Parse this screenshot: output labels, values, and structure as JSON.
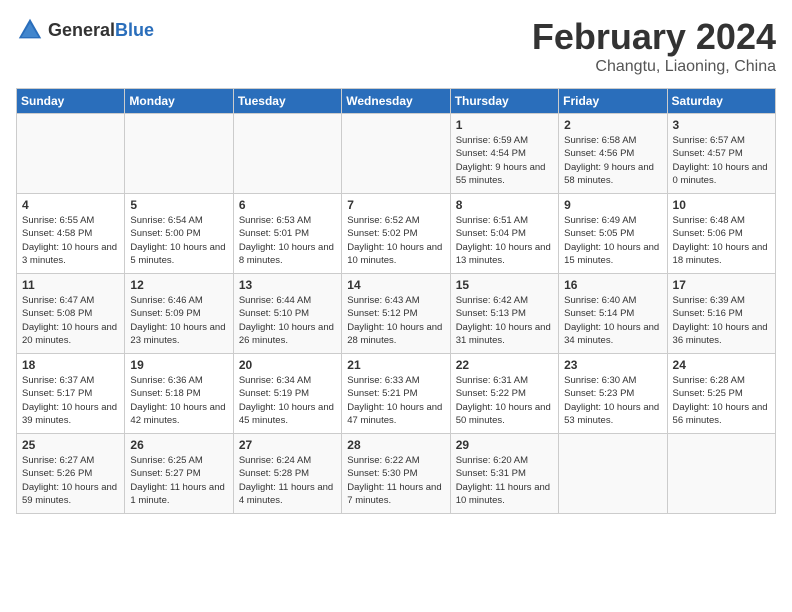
{
  "header": {
    "logo_general": "General",
    "logo_blue": "Blue",
    "month": "February 2024",
    "location": "Changtu, Liaoning, China"
  },
  "weekdays": [
    "Sunday",
    "Monday",
    "Tuesday",
    "Wednesday",
    "Thursday",
    "Friday",
    "Saturday"
  ],
  "weeks": [
    [
      {
        "day": "",
        "info": ""
      },
      {
        "day": "",
        "info": ""
      },
      {
        "day": "",
        "info": ""
      },
      {
        "day": "",
        "info": ""
      },
      {
        "day": "1",
        "info": "Sunrise: 6:59 AM\nSunset: 4:54 PM\nDaylight: 9 hours\nand 55 minutes."
      },
      {
        "day": "2",
        "info": "Sunrise: 6:58 AM\nSunset: 4:56 PM\nDaylight: 9 hours\nand 58 minutes."
      },
      {
        "day": "3",
        "info": "Sunrise: 6:57 AM\nSunset: 4:57 PM\nDaylight: 10 hours\nand 0 minutes."
      }
    ],
    [
      {
        "day": "4",
        "info": "Sunrise: 6:55 AM\nSunset: 4:58 PM\nDaylight: 10 hours\nand 3 minutes."
      },
      {
        "day": "5",
        "info": "Sunrise: 6:54 AM\nSunset: 5:00 PM\nDaylight: 10 hours\nand 5 minutes."
      },
      {
        "day": "6",
        "info": "Sunrise: 6:53 AM\nSunset: 5:01 PM\nDaylight: 10 hours\nand 8 minutes."
      },
      {
        "day": "7",
        "info": "Sunrise: 6:52 AM\nSunset: 5:02 PM\nDaylight: 10 hours\nand 10 minutes."
      },
      {
        "day": "8",
        "info": "Sunrise: 6:51 AM\nSunset: 5:04 PM\nDaylight: 10 hours\nand 13 minutes."
      },
      {
        "day": "9",
        "info": "Sunrise: 6:49 AM\nSunset: 5:05 PM\nDaylight: 10 hours\nand 15 minutes."
      },
      {
        "day": "10",
        "info": "Sunrise: 6:48 AM\nSunset: 5:06 PM\nDaylight: 10 hours\nand 18 minutes."
      }
    ],
    [
      {
        "day": "11",
        "info": "Sunrise: 6:47 AM\nSunset: 5:08 PM\nDaylight: 10 hours\nand 20 minutes."
      },
      {
        "day": "12",
        "info": "Sunrise: 6:46 AM\nSunset: 5:09 PM\nDaylight: 10 hours\nand 23 minutes."
      },
      {
        "day": "13",
        "info": "Sunrise: 6:44 AM\nSunset: 5:10 PM\nDaylight: 10 hours\nand 26 minutes."
      },
      {
        "day": "14",
        "info": "Sunrise: 6:43 AM\nSunset: 5:12 PM\nDaylight: 10 hours\nand 28 minutes."
      },
      {
        "day": "15",
        "info": "Sunrise: 6:42 AM\nSunset: 5:13 PM\nDaylight: 10 hours\nand 31 minutes."
      },
      {
        "day": "16",
        "info": "Sunrise: 6:40 AM\nSunset: 5:14 PM\nDaylight: 10 hours\nand 34 minutes."
      },
      {
        "day": "17",
        "info": "Sunrise: 6:39 AM\nSunset: 5:16 PM\nDaylight: 10 hours\nand 36 minutes."
      }
    ],
    [
      {
        "day": "18",
        "info": "Sunrise: 6:37 AM\nSunset: 5:17 PM\nDaylight: 10 hours\nand 39 minutes."
      },
      {
        "day": "19",
        "info": "Sunrise: 6:36 AM\nSunset: 5:18 PM\nDaylight: 10 hours\nand 42 minutes."
      },
      {
        "day": "20",
        "info": "Sunrise: 6:34 AM\nSunset: 5:19 PM\nDaylight: 10 hours\nand 45 minutes."
      },
      {
        "day": "21",
        "info": "Sunrise: 6:33 AM\nSunset: 5:21 PM\nDaylight: 10 hours\nand 47 minutes."
      },
      {
        "day": "22",
        "info": "Sunrise: 6:31 AM\nSunset: 5:22 PM\nDaylight: 10 hours\nand 50 minutes."
      },
      {
        "day": "23",
        "info": "Sunrise: 6:30 AM\nSunset: 5:23 PM\nDaylight: 10 hours\nand 53 minutes."
      },
      {
        "day": "24",
        "info": "Sunrise: 6:28 AM\nSunset: 5:25 PM\nDaylight: 10 hours\nand 56 minutes."
      }
    ],
    [
      {
        "day": "25",
        "info": "Sunrise: 6:27 AM\nSunset: 5:26 PM\nDaylight: 10 hours\nand 59 minutes."
      },
      {
        "day": "26",
        "info": "Sunrise: 6:25 AM\nSunset: 5:27 PM\nDaylight: 11 hours\nand 1 minute."
      },
      {
        "day": "27",
        "info": "Sunrise: 6:24 AM\nSunset: 5:28 PM\nDaylight: 11 hours\nand 4 minutes."
      },
      {
        "day": "28",
        "info": "Sunrise: 6:22 AM\nSunset: 5:30 PM\nDaylight: 11 hours\nand 7 minutes."
      },
      {
        "day": "29",
        "info": "Sunrise: 6:20 AM\nSunset: 5:31 PM\nDaylight: 11 hours\nand 10 minutes."
      },
      {
        "day": "",
        "info": ""
      },
      {
        "day": "",
        "info": ""
      }
    ]
  ]
}
